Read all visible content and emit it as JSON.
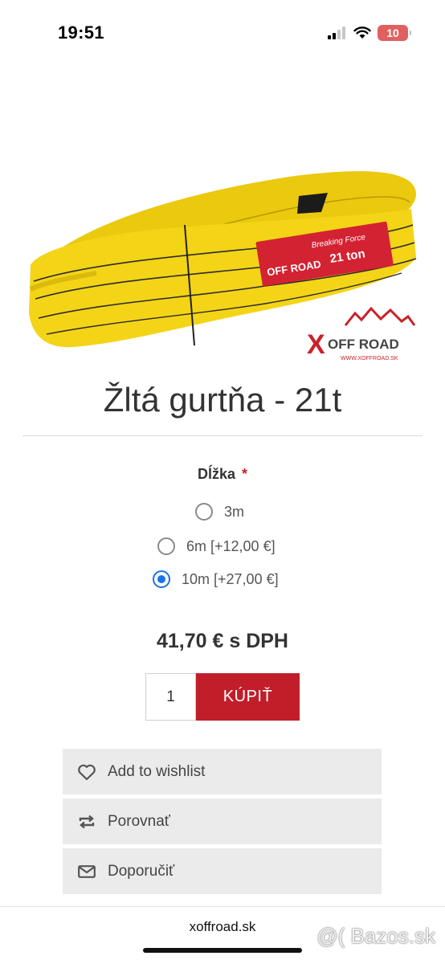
{
  "status_bar": {
    "time": "19:51",
    "battery": "10"
  },
  "product": {
    "image_badge_small": "Breaking Force",
    "image_badge_big": "21 ton",
    "image_tag_brand": "OFF ROAD",
    "logo_text": "OFF ROAD",
    "logo_url": "WWW.XOFFROAD.SK",
    "title": "Žltá gurtňa - 21t"
  },
  "options": {
    "label": "Dĺžka",
    "required_mark": "*",
    "choices": [
      {
        "label": "3m",
        "checked": false
      },
      {
        "label": "6m [+12,00 €]",
        "checked": false
      },
      {
        "label": "10m [+27,00 €]",
        "checked": true
      }
    ]
  },
  "purchase": {
    "price": "41,70 € s DPH",
    "quantity": "1",
    "buy_label": "KÚPIŤ"
  },
  "actions": [
    {
      "label": "Add to wishlist",
      "icon": "heart-icon"
    },
    {
      "label": "Porovnať",
      "icon": "compare-icon"
    },
    {
      "label": "Doporučiť",
      "icon": "mail-icon"
    }
  ],
  "footer": {
    "domain": "xoffroad.sk",
    "watermark": "@( Bazos.sk"
  },
  "colors": {
    "accent": "#c11e2a",
    "radio_checked": "#1a73e8",
    "strap_yellow": "#f4d416"
  }
}
